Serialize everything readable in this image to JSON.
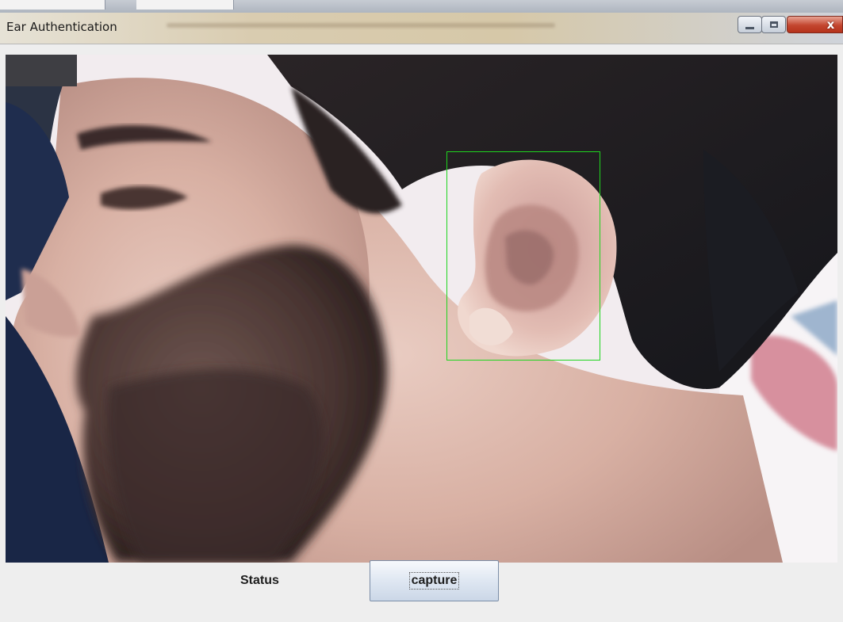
{
  "window": {
    "title": "Ear Authentication",
    "controls": {
      "minimize_icon": "minimize-icon",
      "maximize_icon": "maximize-icon",
      "close_icon": "close-icon",
      "close_glyph": "x"
    }
  },
  "camera": {
    "detection_box_color": "#1fd51f"
  },
  "controls": {
    "status_label": "Status",
    "capture_label": "capture"
  }
}
